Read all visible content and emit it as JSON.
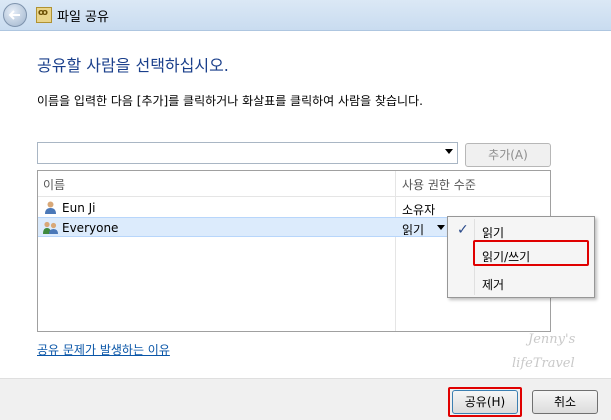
{
  "window": {
    "title": "파일 공유",
    "icons": {
      "back": "back-arrow-icon",
      "app": "file-share-icon"
    }
  },
  "heading": "공유할 사람을 선택하십시오.",
  "instruction": "이름을 입력한 다음 [추가]를 클릭하거나 화살표를 클릭하여 사람을 찾습니다.",
  "name_input": {
    "value": ""
  },
  "add_button": "추가(A)",
  "table": {
    "columns": [
      "이름",
      "사용 권한 수준"
    ],
    "rows": [
      {
        "name": "Eun Ji",
        "permission": "소유자",
        "icon": "user-icon"
      },
      {
        "name": "Everyone",
        "permission": "읽기",
        "icon": "group-icon",
        "selected": true
      }
    ]
  },
  "permission_menu": {
    "items": [
      {
        "label": "읽기",
        "checked": true
      },
      {
        "label": "읽기/쓰기",
        "highlighted": true
      },
      {
        "label": "제거"
      }
    ]
  },
  "help_link": "공유 문제가 발생하는 이유",
  "buttons": {
    "share": "공유(H)",
    "cancel": "취소"
  },
  "watermark": {
    "line1": "Jenny's",
    "line2": "lifeTravel"
  },
  "colors": {
    "heading": "#1a3f8b",
    "link": "#0a56a8",
    "highlight": "#e00000"
  }
}
